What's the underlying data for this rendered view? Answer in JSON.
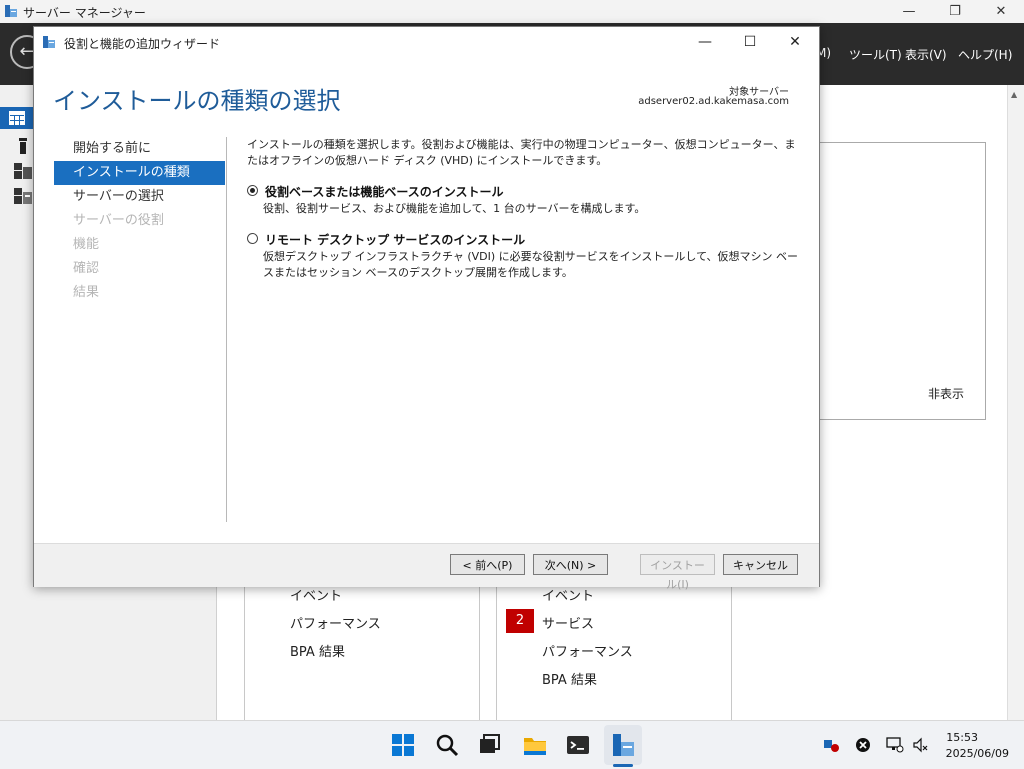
{
  "server_manager": {
    "title": "サーバー マネージャー",
    "menu": [
      "M)",
      "ツール(T)",
      "表示(V)",
      "ヘルプ(H)"
    ],
    "hide_label": "非表示",
    "tile_left": [
      "イベント",
      "パフォーマンス",
      "BPA 結果"
    ],
    "tile_right": [
      "イベント",
      "サービス",
      "パフォーマンス",
      "BPA 結果"
    ],
    "badge_count": "2"
  },
  "wizard": {
    "title": "役割と機能の追加ウィザード",
    "heading": "インストールの種類の選択",
    "target_label": "対象サーバー",
    "target_value": "adserver02.ad.kakemasa.com",
    "nav": [
      {
        "label": "開始する前に",
        "state": "normal"
      },
      {
        "label": "インストールの種類",
        "state": "active"
      },
      {
        "label": "サーバーの選択",
        "state": "normal"
      },
      {
        "label": "サーバーの役割",
        "state": "disabled"
      },
      {
        "label": "機能",
        "state": "disabled"
      },
      {
        "label": "確認",
        "state": "disabled"
      },
      {
        "label": "結果",
        "state": "disabled"
      }
    ],
    "description": "インストールの種類を選択します。役割および機能は、実行中の物理コンピューター、仮想コンピューター、またはオフラインの仮想ハード ディスク (VHD) にインストールできます。",
    "options": [
      {
        "label": "役割ベースまたは機能ベースのインストール",
        "desc": "役割、役割サービス、および機能を追加して、1 台のサーバーを構成します。",
        "checked": true
      },
      {
        "label": "リモート デスクトップ サービスのインストール",
        "desc": "仮想デスクトップ インフラストラクチャ (VDI) に必要な役割サービスをインストールして、仮想マシン ベースまたはセッション ベースのデスクトップ展開を作成します。",
        "checked": false
      }
    ],
    "buttons": {
      "prev": "< 前へ(P)",
      "next": "次へ(N) >",
      "install": "インストール(I)",
      "cancel": "キャンセル"
    }
  },
  "taskbar": {
    "time": "15:53",
    "date": "2025/06/09"
  },
  "colors": {
    "accent": "#1a6fc0",
    "heading": "#1f5c99",
    "badge": "#c00000"
  }
}
